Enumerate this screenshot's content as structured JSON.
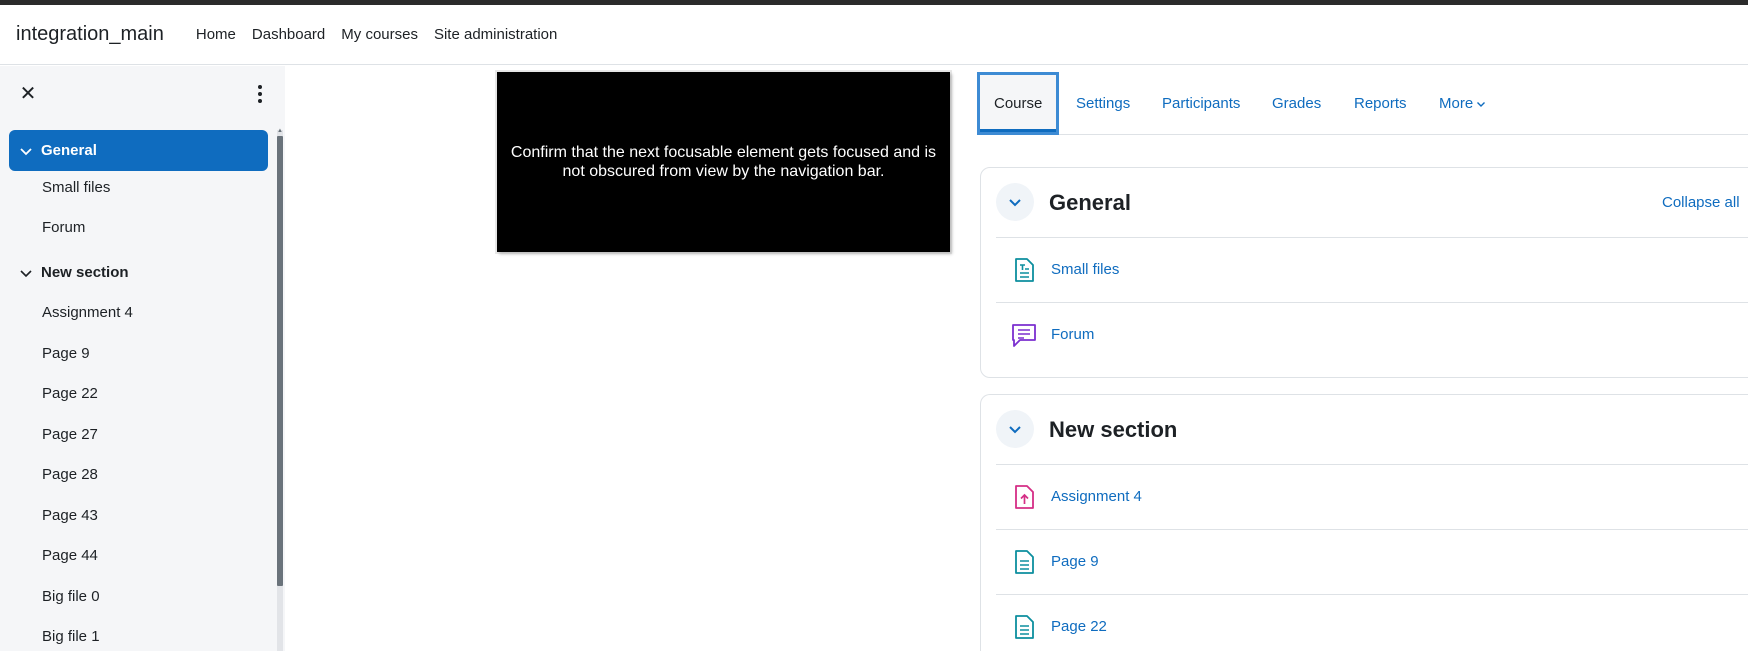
{
  "navbar": {
    "brand": "integration_main",
    "links": [
      "Home",
      "Dashboard",
      "My courses",
      "Site administration"
    ]
  },
  "drawer": {
    "close_icon": "close-icon",
    "menu_icon": "kebab-menu-icon",
    "sections": [
      {
        "title": "General",
        "active": true,
        "items": [
          "Small files",
          "Forum"
        ]
      },
      {
        "title": "New section",
        "active": false,
        "items": [
          "Assignment 4",
          "Page 9",
          "Page 22",
          "Page 27",
          "Page 28",
          "Page 43",
          "Page 44",
          "Big file 0",
          "Big file 1"
        ]
      }
    ]
  },
  "overlay": {
    "message": "Confirm that the next focusable element gets focused and is not obscured from view by the navigation bar."
  },
  "tabs": {
    "items": [
      "Course",
      "Settings",
      "Participants",
      "Grades",
      "Reports",
      "More"
    ],
    "active": "Course"
  },
  "course": {
    "collapse_all": "Collapse all",
    "sections": [
      {
        "title": "General",
        "activities": [
          {
            "name": "Small files",
            "icon": "resource-icon",
            "color": "#0d8f9f"
          },
          {
            "name": "Forum",
            "icon": "forum-icon",
            "color": "#7b2fcf"
          }
        ]
      },
      {
        "title": "New section",
        "activities": [
          {
            "name": "Assignment 4",
            "icon": "assignment-icon",
            "color": "#d52e86"
          },
          {
            "name": "Page 9",
            "icon": "page-icon",
            "color": "#0d8f9f"
          },
          {
            "name": "Page 22",
            "icon": "page-icon",
            "color": "#0d8f9f"
          }
        ]
      }
    ]
  },
  "colors": {
    "primary": "#0f6cbf",
    "drawer_bg": "#f5f6f8",
    "overlay_bg": "#000000"
  }
}
